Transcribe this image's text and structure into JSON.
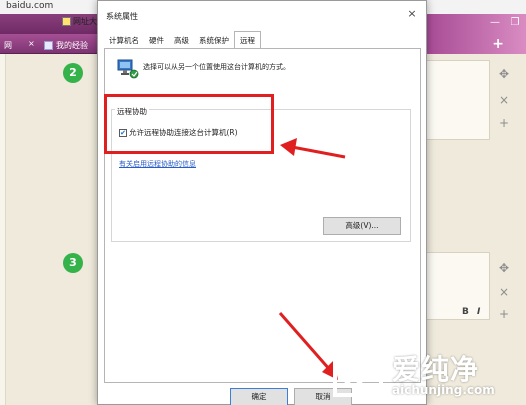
{
  "browser": {
    "url": "baidu.com",
    "bookmarks": [
      "网址大全"
    ],
    "tabs": [
      "网",
      "我的经验"
    ],
    "tab_close": "×",
    "new_tab": "+"
  },
  "page": {
    "steps": [
      "2",
      "3"
    ],
    "side_tools": [
      "✥",
      "×",
      "+"
    ],
    "format_bold": "B",
    "format_italic": "I"
  },
  "dialog": {
    "title": "系统属性",
    "close": "×",
    "tabs": [
      "计算机名",
      "硬件",
      "高级",
      "系统保护",
      "远程"
    ],
    "active_tab": "远程",
    "intro": "选择可以从另一个位置使用这台计算机的方式。",
    "group_title": "远程协助",
    "checkbox_label": "允许远程协助连接这台计算机(R)",
    "checkbox_checked": true,
    "help_link": "有关启用远程协助的信息",
    "advanced_button": "高级(V)...",
    "ok_button": "确定",
    "cancel_button": "取消"
  },
  "annotation": {
    "color": "#e02020"
  },
  "watermark": {
    "brand": "爱纯净",
    "url": "aichunjing.com"
  }
}
